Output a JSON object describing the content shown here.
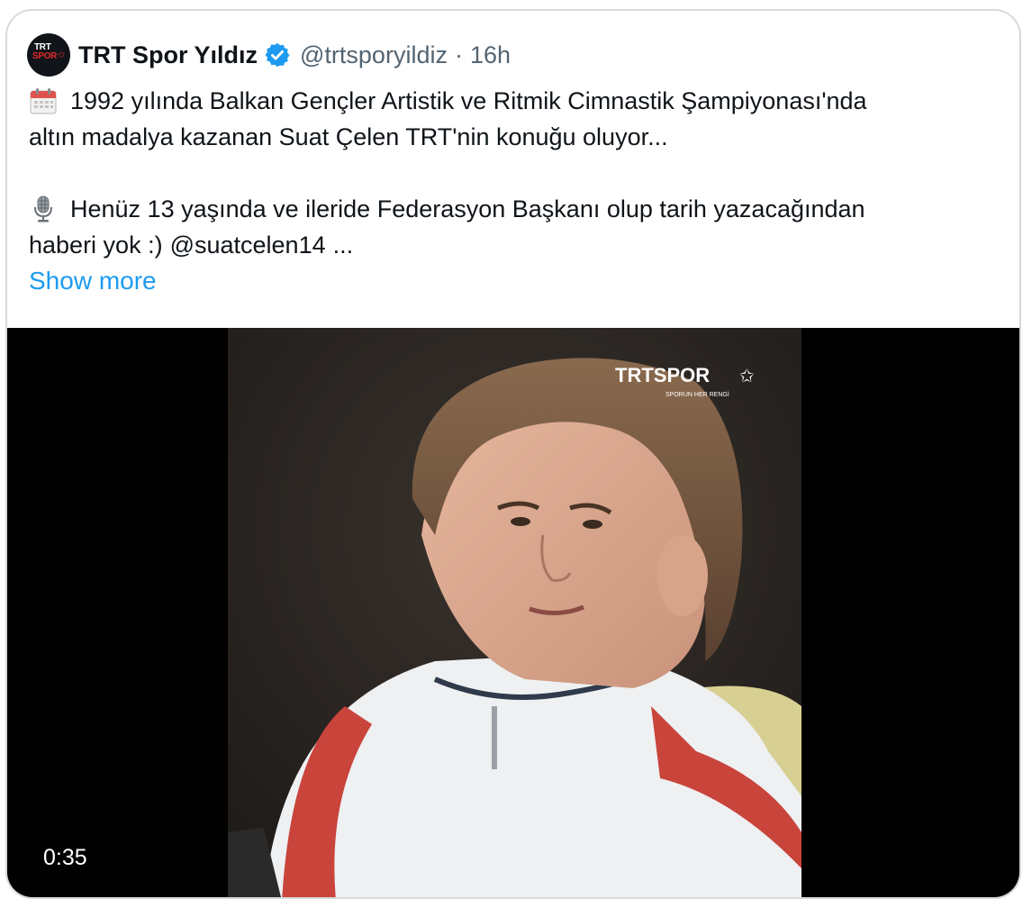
{
  "tweet": {
    "author": {
      "display_name": "TRT Spor Yıldız",
      "handle": "@trtsporyildiz",
      "separator": "·",
      "time": "16h",
      "verified": true,
      "avatar_text_top": "TRT",
      "avatar_text_bottom": "SPOR"
    },
    "text": {
      "line1": "1992 yılında Balkan Gençler Artistik ve Ritmik Cimnastik Şampiyonası'nda",
      "line2": "altın madalya kazanan Suat Çelen TRT'nin konuğu oluyor...",
      "line3": "Henüz 13 yaşında ve ileride Federasyon Başkanı olup tarih yazacağından",
      "line4_prefix": "haberi yok :)",
      "line4_mention": "@suatcelen14",
      "line4_suffix": "..."
    },
    "show_more_label": "Show more",
    "icons": {
      "line1": "calendar-icon",
      "line3": "microphone-icon",
      "verified": "verified-badge-icon"
    },
    "video": {
      "duration": "0:35",
      "watermark_main": "TRTSPOR",
      "watermark_tagline": "SPORUN HER RENGİ"
    },
    "colors": {
      "accent": "#1d9bf0",
      "text": "#0f1419",
      "muted": "#536471",
      "brand_red": "#e4282c"
    }
  }
}
